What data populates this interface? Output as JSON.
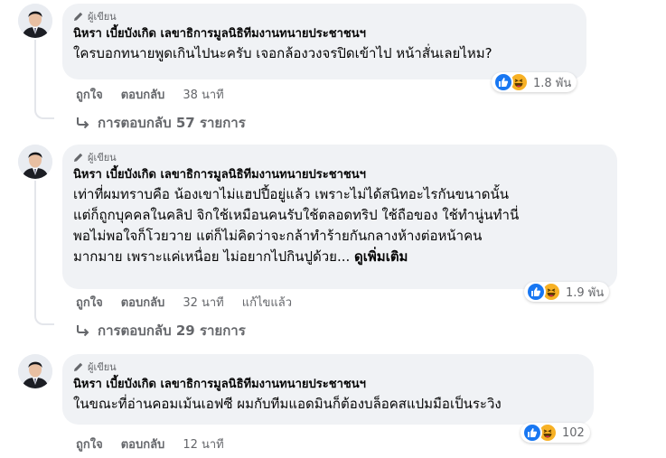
{
  "comments": [
    {
      "badge": "ผู้เขียน",
      "author": "นิหรา เบี้ยบังเกิด เลขาธิการมูลนิธิทีมงานทนายประชาชนฯ",
      "lines": [
        "ใครบอกทนายพูดเกินไปนะครับ เจอกล้องวงจรปิดเข้าไป หน้าสั่นเลยไหม?"
      ],
      "see_more": "",
      "reaction_count": "1.8 พัน",
      "like_label": "ถูกใจ",
      "reply_label": "ตอบกลับ",
      "time": "38 นาที",
      "edited": "",
      "replies_label": "การตอบกลับ 57 รายการ"
    },
    {
      "badge": "ผู้เขียน",
      "author": "นิหรา เบี้ยบังเกิด เลขาธิการมูลนิธิทีมงานทนายประชาชนฯ",
      "lines": [
        "เท่าที่ผมทราบคือ น้องเขาไม่แฮปปี้อยู่แล้ว เพราะไม่ได้สนิทอะไรกันขนาดนั้น",
        "แต่ก็ถูกบุคคลในคลิป จิกใช้เหมือนคนรับใช้ตลอดทริป ใช้ถือของ ใช้ทำนู่นทำนี่",
        "พอไม่พอใจก็โวยวาย แต่ก็ไม่คิดว่าจะกล้าทำร้ายกันกลางห้างต่อหน้าคน",
        "มากมาย เพราะแค่เหนื่อย ไม่อยากไปกินปูด้วย..."
      ],
      "see_more": "ดูเพิ่มเติม",
      "reaction_count": "1.9 พัน",
      "like_label": "ถูกใจ",
      "reply_label": "ตอบกลับ",
      "time": "32 นาที",
      "edited": "แก้ไขแล้ว",
      "replies_label": "การตอบกลับ 29 รายการ"
    },
    {
      "badge": "ผู้เขียน",
      "author": "นิหรา เบี้ยบังเกิด เลขาธิการมูลนิธิทีมงานทนายประชาชนฯ",
      "lines": [
        "ในขณะที่อ่านคอมเม้นเอฟซี ผมกับทีมแอดมินก็ต้องบล็อคสแปมมือเป็นระวิง"
      ],
      "see_more": "",
      "reaction_count": "102",
      "like_label": "ถูกใจ",
      "reply_label": "ตอบกลับ",
      "time": "12 นาที",
      "edited": "",
      "replies_label": ""
    }
  ],
  "icons": {
    "badge": "pencil-icon",
    "like": "thumbs-up-icon",
    "haha": "laughing-face-icon",
    "reply_arrow": "reply-arrow-icon"
  },
  "colors": {
    "bubble": "#f0f2f5",
    "secondary_text": "#65676b",
    "like_blue": "#1877f2",
    "haha_yellow": "#f7b125"
  }
}
